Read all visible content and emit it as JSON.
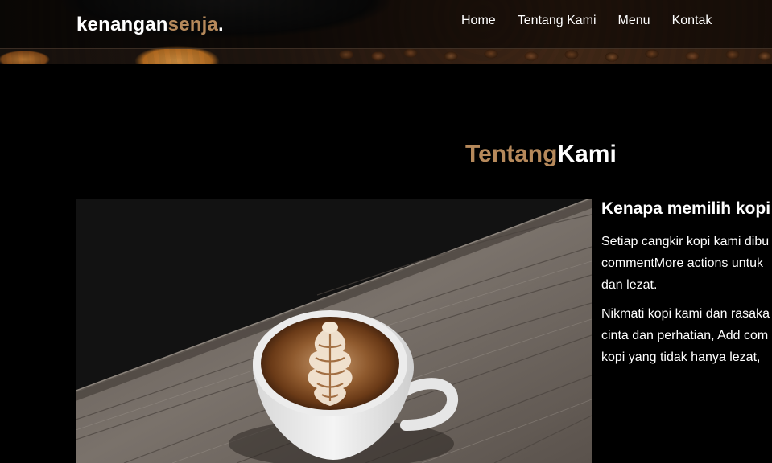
{
  "brand": {
    "name_main": "kenangan",
    "name_accent": "senja",
    "name_dot": "."
  },
  "nav": {
    "items": [
      {
        "label": "Home"
      },
      {
        "label": "Tentang Kami"
      },
      {
        "label": "Menu"
      },
      {
        "label": "Kontak"
      }
    ]
  },
  "about": {
    "title_accent": "Tentang",
    "title_main": "Kami",
    "heading": "Kenapa memilih kopi",
    "paragraph1": {
      "line1": "Setiap cangkir kopi kami dibu",
      "line2": "commentMore actions untuk",
      "line3": "dan lezat."
    },
    "paragraph2": {
      "line1": "Nikmati kopi kami dan rasaka",
      "line2": "cinta dan perhatian, Add com",
      "line3": "kopi yang tidak hanya lezat, "
    },
    "image": {
      "icon": "latte-art-coffee-cup-image"
    }
  },
  "colors": {
    "accent": "#b6895b",
    "background": "#000000",
    "text": "#ffffff"
  }
}
